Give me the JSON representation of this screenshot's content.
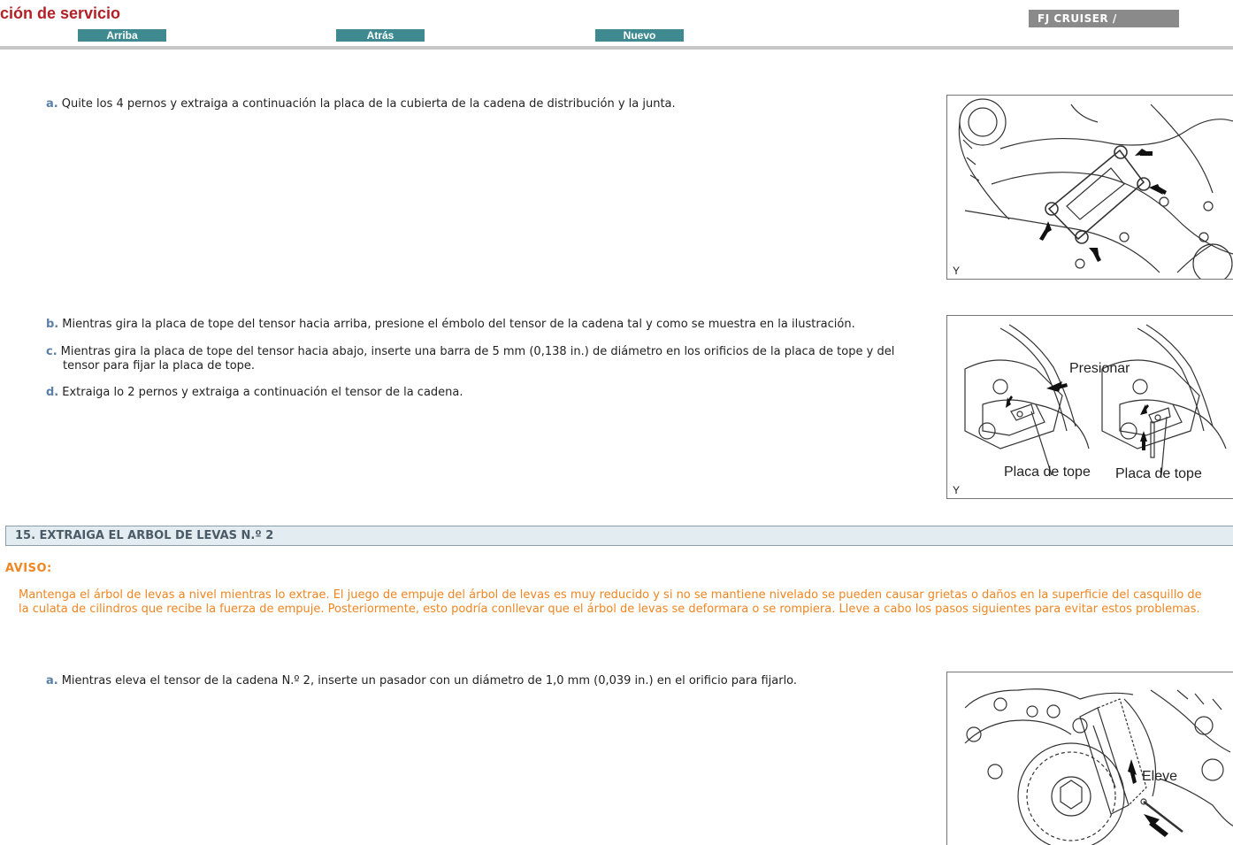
{
  "header": {
    "title": "ción de servicio",
    "nav": [
      "Arriba",
      "Atrás",
      "Nuevo"
    ],
    "model": "FJ CRUISER /"
  },
  "steps_group1": [
    {
      "letter": "a.",
      "text": "Quite los 4 pernos y extraiga a continuación la placa de la cubierta de la cadena de distribución y la junta."
    }
  ],
  "figure1": {
    "corner_label": "Y"
  },
  "steps_group2": [
    {
      "letter": "b.",
      "text": "Mientras gira la placa de tope del tensor hacia arriba, presione el émbolo del tensor de la cadena tal y como se muestra en la ilustración."
    },
    {
      "letter": "c.",
      "line1": "Mientras gira la placa de tope del tensor hacia abajo, inserte una barra de 5 mm (0,138 in.) de diámetro en los orificios de la placa de tope y del",
      "line2": "tensor para fijar la placa de tope."
    },
    {
      "letter": "d.",
      "text": "Extraiga lo 2 pernos y extraiga a continuación el tensor de la cadena."
    }
  ],
  "figure2": {
    "corner_label": "Y",
    "label_push": "Presionar",
    "label_plate_left": "Placa de tope",
    "label_plate_right": "Placa de tope"
  },
  "section": {
    "title": "15. EXTRAIGA EL ARBOL DE LEVAS N.º 2"
  },
  "aviso": {
    "title": "AVISO:",
    "line1": "Mantenga el árbol de levas a nivel mientras lo extrae. El juego de empuje del árbol de levas es muy reducido y si no se mantiene nivelado se pueden causar grietas o daños en la superficie del casquillo de",
    "line2": "la culata de cilindros que recibe la fuerza de empuje. Posteriormente, esto podría conllevar que el árbol de levas se deformara o se rompiera. Lleve a cabo los pasos siguientes para evitar estos problemas."
  },
  "steps_group3": [
    {
      "letter": "a.",
      "text": "Mientras eleva el tensor de la cadena N.º 2, inserte un pasador con un diámetro de 1,0 mm (0,039 in.) en el orificio para fijarlo."
    }
  ],
  "figure3": {
    "label_lift": "Eleve"
  },
  "colors": {
    "title_red": "#b21f24",
    "nav_teal": "#3f8a91",
    "warning_orange": "#f08622",
    "step_letter_blue": "#5b7fa7"
  }
}
